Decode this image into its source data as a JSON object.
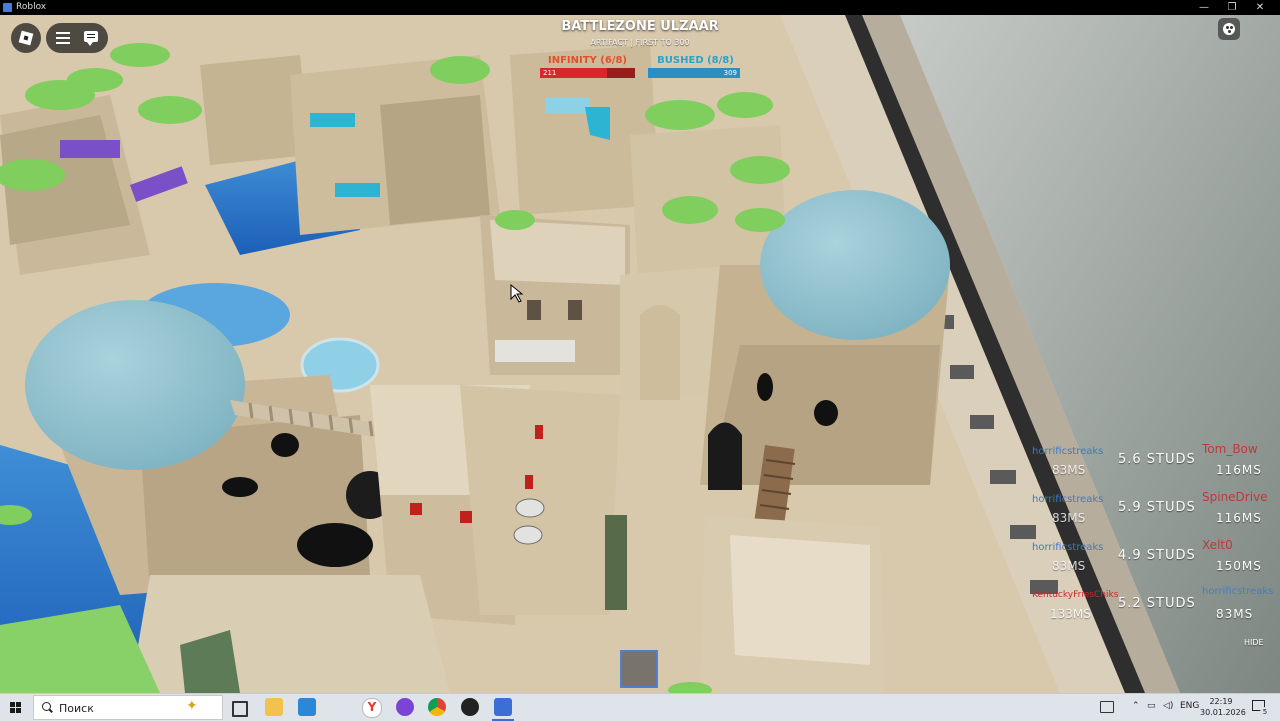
{
  "window": {
    "title": "Roblox"
  },
  "hud": {
    "map_name": "BATTLEZONE ULZAAR",
    "mode": "ARTIFACT | FIRST TO 300",
    "team_left": {
      "name": "INFINITY (6/8)",
      "score": "211",
      "color": "#e0512b",
      "fill": 0.7
    },
    "team_right": {
      "name": "BUSHED (8/8)",
      "score": "309",
      "color": "#2aa3c9",
      "fill": 1.0
    }
  },
  "scoreboard": {
    "rows": [
      {
        "name": "horrificstreaks",
        "ping": "83MS",
        "distance": "5.6 STUDS",
        "opponent": "Tom_Bow",
        "opponent_ping": "116MS"
      },
      {
        "name": "horrificstreaks",
        "ping": "83MS",
        "distance": "5.9 STUDS",
        "opponent": "SpineDrive",
        "opponent_ping": "116MS"
      },
      {
        "name": "horrificstreaks",
        "ping": "83MS",
        "distance": "4.9 STUDS",
        "opponent": "Xelt0",
        "opponent_ping": "150MS"
      },
      {
        "name": "KentuckyFriesChiks",
        "ping": "133MS",
        "distance": "5.2 STUDS",
        "opponent": "horrificstreaks",
        "opponent_ping": "83MS"
      }
    ],
    "hide_label": "HIDE"
  },
  "taskbar": {
    "search_placeholder": "Поиск",
    "language": "ENG",
    "time": "22:19",
    "date": "30.01.2026",
    "notification_count": "5"
  },
  "icons": {
    "roblox_menu": "roblox-logo-icon",
    "menu": "hamburger-menu-icon",
    "chat": "chat-icon",
    "palette": "palette-icon",
    "windows": "windows-start-icon",
    "search": "search-icon"
  }
}
